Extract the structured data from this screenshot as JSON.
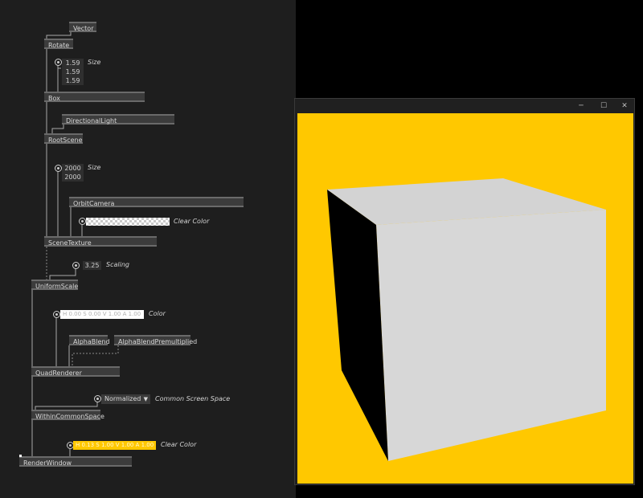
{
  "patch": {
    "nodes": {
      "vector": "Vector",
      "rotate": "Rotate",
      "box": "Box",
      "directional_light": "DirectionalLight",
      "root_scene": "RootScene",
      "orbit_camera": "OrbitCamera",
      "scene_texture": "SceneTexture",
      "uniform_scale": "UniformScale",
      "alpha_blend": "AlphaBlend",
      "alpha_blend_premultiplied": "AlphaBlendPremultiplied",
      "quad_renderer": "QuadRenderer",
      "within_common_space": "WithinCommonSpace",
      "render_window": "RenderWindow"
    },
    "box_size": {
      "values": [
        "1.59",
        "1.59",
        "1.59"
      ],
      "label": "Size"
    },
    "texture_size": {
      "values": [
        "2000",
        "2000"
      ],
      "label": "Size"
    },
    "texture_clear_color": {
      "label": "Clear Color"
    },
    "scaling": {
      "value": "3.25",
      "label": "Scaling"
    },
    "quad_color": {
      "value": "H 0.00 S 0.00 V 1.00 A 1.00",
      "label": "Color",
      "bg": "#ffffff"
    },
    "screen_space": {
      "value": "Normalized",
      "label": "Common Screen Space"
    },
    "window_clear_color": {
      "value": "H 0.13 S 1.00 V 1.00 A 1.00",
      "label": "Clear Color",
      "bg": "#ffc800"
    }
  },
  "window": {
    "controls": {
      "minimize": "─",
      "maximize": "☐",
      "close": "✕"
    },
    "viewport_color": "#ffc800",
    "cube": {
      "top": "#d3d3d3",
      "front": "#d7d7d7",
      "side": "#000000"
    }
  }
}
